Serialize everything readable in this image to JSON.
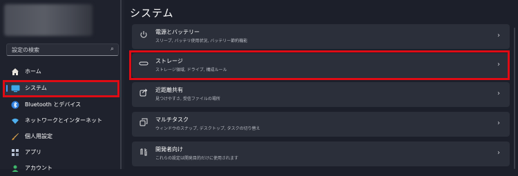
{
  "page_title": "システム",
  "search": {
    "placeholder": "設定の検索"
  },
  "sidebar": {
    "items": [
      {
        "label": "ホーム",
        "icon": "home-icon"
      },
      {
        "label": "システム",
        "icon": "display-icon",
        "selected": true
      },
      {
        "label": "Bluetooth とデバイス",
        "icon": "bluetooth-icon"
      },
      {
        "label": "ネットワークとインターネット",
        "icon": "wifi-icon"
      },
      {
        "label": "個人用設定",
        "icon": "brush-icon"
      },
      {
        "label": "アプリ",
        "icon": "apps-icon"
      },
      {
        "label": "アカウント",
        "icon": "person-icon"
      }
    ]
  },
  "cards": [
    {
      "title": "電源とバッテリー",
      "subtitle": "スリープ, バッテリ使用状況, バッテリー節約機能",
      "icon": "power-icon"
    },
    {
      "title": "ストレージ",
      "subtitle": "ストレージ領域, ドライブ, 構成ルール",
      "icon": "storage-icon"
    },
    {
      "title": "近距離共有",
      "subtitle": "見つけやすさ, 受信ファイルの場所",
      "icon": "share-icon"
    },
    {
      "title": "マルチタスク",
      "subtitle": "ウィンドウのスナップ, デスクトップ, タスクの切り替え",
      "icon": "multitask-icon"
    },
    {
      "title": "開発者向け",
      "subtitle": "これらの設定は開発目的だけに使用されます",
      "icon": "developer-icon"
    }
  ],
  "colors": {
    "highlight": "#e00b14",
    "accent": "#3fa0ff"
  }
}
